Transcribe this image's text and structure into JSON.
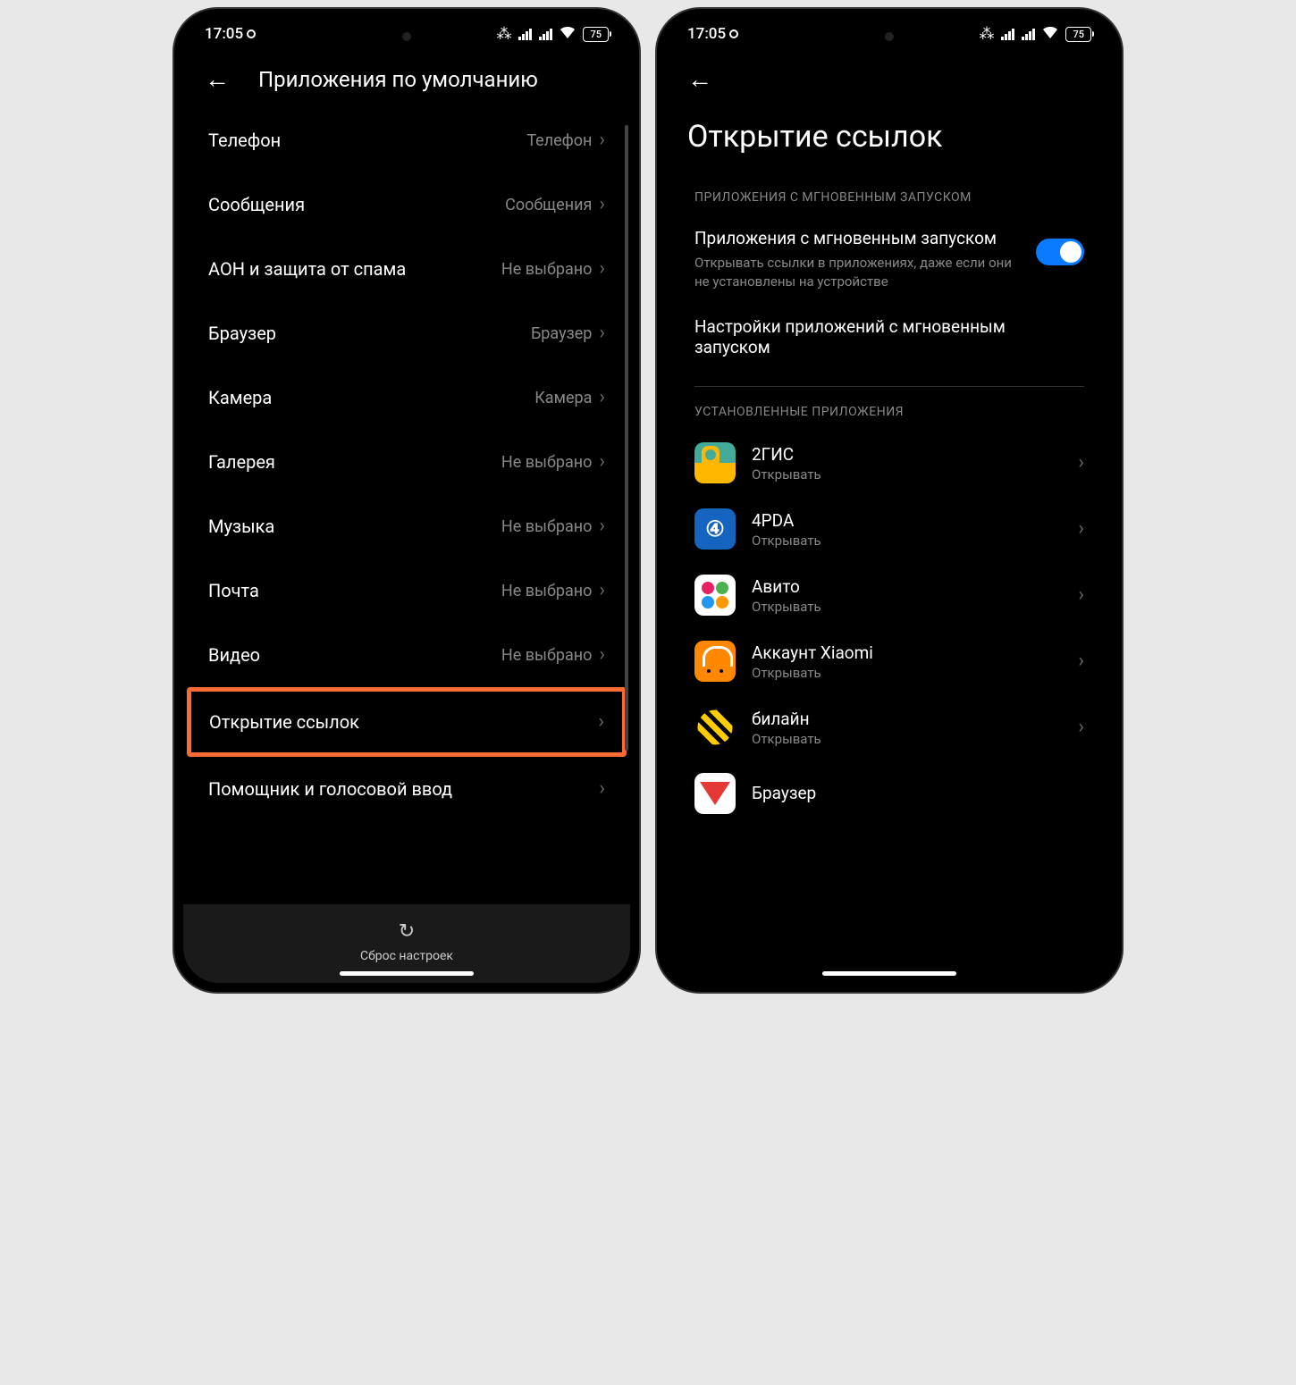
{
  "status": {
    "time": "17:05",
    "battery": "75"
  },
  "left": {
    "title": "Приложения по умолчанию",
    "rows": [
      {
        "label": "Телефон",
        "value": "Телефон"
      },
      {
        "label": "Сообщения",
        "value": "Сообщения"
      },
      {
        "label": "АОН и защита от спама",
        "value": "Не выбрано"
      },
      {
        "label": "Браузер",
        "value": "Браузер"
      },
      {
        "label": "Камера",
        "value": "Камера"
      },
      {
        "label": "Галерея",
        "value": "Не выбрано"
      },
      {
        "label": "Музыка",
        "value": "Не выбрано"
      },
      {
        "label": "Почта",
        "value": "Не выбрано"
      },
      {
        "label": "Видео",
        "value": "Не выбрано"
      },
      {
        "label": "Открытие ссылок",
        "value": ""
      },
      {
        "label": "Помощник и голосовой ввод",
        "value": ""
      }
    ],
    "reset": "Сброс настроек"
  },
  "right": {
    "title": "Открытие ссылок",
    "section1": "ПРИЛОЖЕНИЯ С МГНОВЕННЫМ ЗАПУСКОМ",
    "toggle": {
      "title": "Приложения с мгновенным запуском",
      "subtitle": "Открывать ссылки в приложениях, даже если они не установлены на устройстве"
    },
    "settings_link": "Настройки приложений с мгновенным запуском",
    "section2": "УСТАНОВЛЕННЫЕ ПРИЛОЖЕНИЯ",
    "apps": [
      {
        "name": "2ГИС",
        "sub": "Открывать"
      },
      {
        "name": "4PDA",
        "sub": "Открывать"
      },
      {
        "name": "Авито",
        "sub": "Открывать"
      },
      {
        "name": "Аккаунт Xiaomi",
        "sub": "Открывать"
      },
      {
        "name": "билайн",
        "sub": "Открывать"
      },
      {
        "name": "Браузер",
        "sub": ""
      }
    ]
  }
}
